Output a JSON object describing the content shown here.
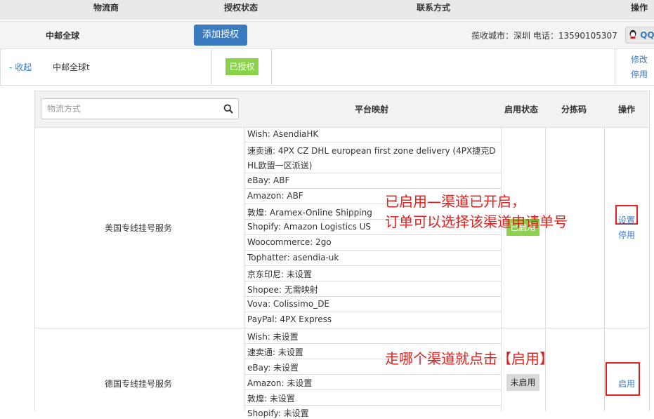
{
  "header": {
    "col_carrier": "物流商",
    "col_auth": "授权状态",
    "col_contact": "联系方式",
    "col_action": "操作"
  },
  "carrier_bar": {
    "name": "中邮全球",
    "add_auth_label": "添加授权",
    "contact_text": "揽收城市：深圳  电话：13590105307",
    "qq_label": "QQ"
  },
  "carrier_row": {
    "collapse_label": "- 收起",
    "name": "中邮全球t",
    "auth_status": "已授权",
    "edit_label": "修改",
    "disable_label": "停用"
  },
  "service_table": {
    "search_placeholder": "物流方式",
    "col_mapping": "平台映射",
    "col_status": "启用状态",
    "col_sort_code": "分拣码",
    "col_action": "操作",
    "rows": [
      {
        "name": "美国专线挂号服务",
        "mappings": [
          "Wish:  AsendiaHK",
          "速卖通:  4PX CZ DHL european first zone delivery (4PX捷克D",
          "HL欧盟一区派送)",
          "eBay:  ABF",
          "Amazon:  ABF",
          "敦煌:  Aramex-Online Shipping",
          "Shopify:  Amazon Logistics US",
          "Woocommerce:  2go",
          "Tophatter:  asendia-uk",
          "京东印尼:  未设置",
          "Shopee:  无需映射",
          "Vova:  Colissimo_DE",
          "PayPal:  4PX Express"
        ],
        "status": "已启用",
        "action_set": "设置",
        "action_disable": "停用"
      },
      {
        "name": "德国专线挂号服务",
        "mappings": [
          "Wish:  未设置",
          "速卖通:  未设置",
          "eBay:  未设置",
          "Amazon:  未设置",
          "敦煌:  未设置",
          "Shopify:  未设置"
        ],
        "status": "未启用",
        "action_enable": "启用"
      }
    ]
  },
  "annotations": {
    "note1_line1": "已启用—渠道已开启，",
    "note1_line2": "订单可以选择该渠道申请单号",
    "note2": "走哪个渠道就点击【启用】"
  },
  "colors": {
    "accent_blue": "#3a7bbf",
    "green_badge": "#8ad24a",
    "annotation_red": "#e0201e"
  }
}
